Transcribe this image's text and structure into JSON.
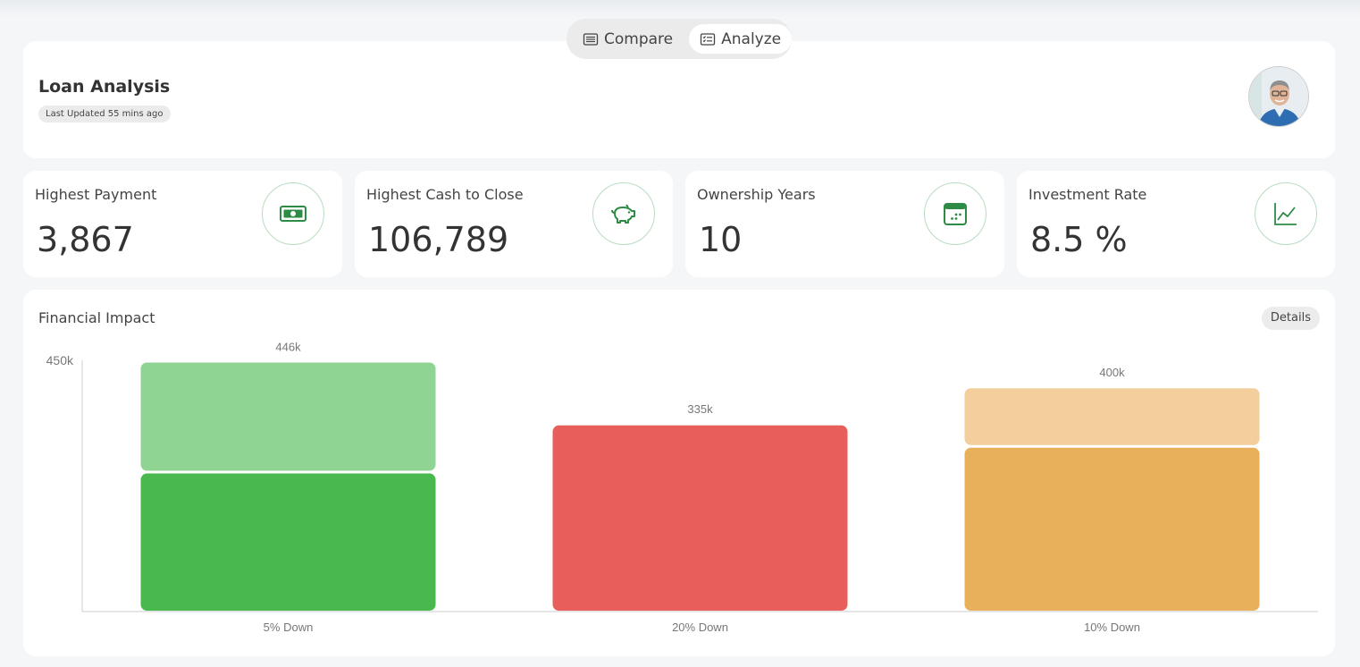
{
  "tabs": [
    {
      "label": "Compare",
      "icon": "list-icon",
      "active": false
    },
    {
      "label": "Analyze",
      "icon": "checklist-icon",
      "active": true
    }
  ],
  "header": {
    "title": "Loan Analysis",
    "updated": "Last Updated 55 mins ago"
  },
  "stats": [
    {
      "label": "Highest Payment",
      "value": "3,867",
      "icon": "cash-icon"
    },
    {
      "label": "Highest Cash to Close",
      "value": "106,789",
      "icon": "piggy-bank-icon"
    },
    {
      "label": "Ownership Years",
      "value": "10",
      "icon": "calendar-icon"
    },
    {
      "label": "Investment Rate",
      "value": "8.5 %",
      "icon": "line-chart-icon"
    }
  ],
  "chart_card": {
    "title": "Financial Impact",
    "details_label": "Details"
  },
  "chart_data": {
    "type": "bar",
    "stacked": true,
    "categories": [
      "5% Down",
      "20% Down",
      "10% Down"
    ],
    "totals": [
      446,
      335,
      400
    ],
    "total_labels": [
      "446k",
      "335k",
      "400k"
    ],
    "segments": [
      {
        "bottom": 249,
        "top": 197,
        "bottom_color": "#48b84f",
        "top_color": "#90d494"
      },
      {
        "bottom": 335,
        "top": 0,
        "bottom_color": "#e85e5a",
        "top_color": "#e85e5a"
      },
      {
        "bottom": 295,
        "top": 105,
        "bottom_color": "#e8b05a",
        "top_color": "#f2cf9d"
      }
    ],
    "y_tick_labels": [
      "450k"
    ],
    "ylim": [
      0,
      450
    ],
    "grid": false,
    "colors": {
      "axis": "#cccccc",
      "text": "#777777"
    }
  },
  "colors": {
    "accent": "#2e8b45",
    "icon_border": "#b9dcc1"
  }
}
